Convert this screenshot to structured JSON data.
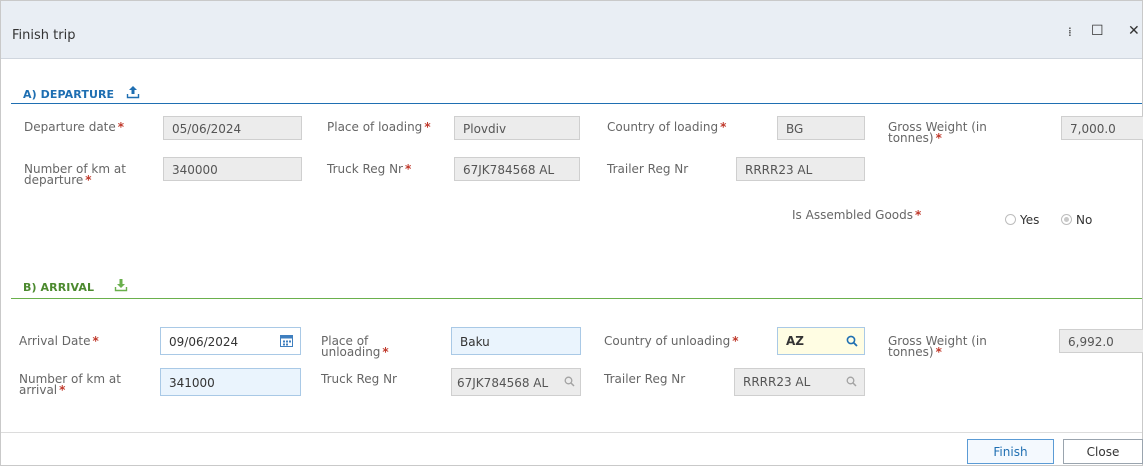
{
  "window": {
    "title": "Finish trip",
    "pin_glyph": "⁞",
    "maximize_glyph": "☐",
    "close_glyph": "✕"
  },
  "departure": {
    "section_title": "A) DEPARTURE",
    "section_icon": "upload-icon",
    "departure_date_label": "Departure date",
    "departure_date": "05/06/2024",
    "place_of_loading_label": "Place of loading",
    "place_of_loading": "Plovdiv",
    "country_of_loading_label": "Country of loading",
    "country_of_loading": "BG",
    "gross_weight_label_1": "Gross Weight (in",
    "gross_weight_label_2": "tonnes)",
    "gross_weight": "7,000.0",
    "km_label_1": "Number of km at",
    "km_label_2": "departure",
    "km": "340000",
    "truck_reg_label": "Truck Reg Nr",
    "truck_reg": "67JK784568 AL",
    "trailer_reg_label": "Trailer Reg Nr",
    "trailer_reg": "RRRR23 AL",
    "assembled_label": "Is Assembled Goods",
    "yes_label": "Yes",
    "no_label": "No"
  },
  "arrival": {
    "section_title": "B) ARRIVAL",
    "section_icon": "download-icon",
    "arrival_date_label": "Arrival Date",
    "arrival_date": "09/06/2024",
    "place_of_unloading_label_1": "Place of",
    "place_of_unloading_label_2": "unloading",
    "place_of_unloading": "Baku",
    "country_of_unloading_label": "Country of unloading",
    "country_of_unloading": "AZ",
    "gross_weight_label_1": "Gross Weight (in",
    "gross_weight_label_2": "tonnes)",
    "gross_weight": "6,992.0",
    "km_label_1": "Number of km at",
    "km_label_2": "arrival",
    "km": "341000",
    "truck_reg_label": "Truck Reg Nr",
    "truck_reg": "67JK784568 AL",
    "trailer_reg_label": "Trailer Reg Nr",
    "trailer_reg": "RRRR23 AL"
  },
  "required_marker": "*",
  "icons": {
    "calendar": "📅",
    "search": "🔍"
  },
  "colors": {
    "departure_accent": "#1f6fb2",
    "arrival_accent": "#6ab04c",
    "required": "#c0392b"
  },
  "buttons": {
    "finish": "Finish",
    "close": "Close"
  }
}
